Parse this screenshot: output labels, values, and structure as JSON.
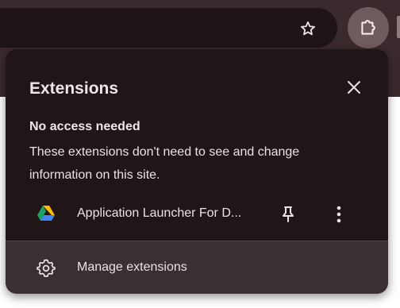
{
  "toolbar": {
    "bookmark_icon": "star-outline-icon",
    "extensions_icon": "puzzle-piece-icon"
  },
  "popup": {
    "title": "Extensions",
    "close_icon": "close-icon",
    "section": {
      "heading": "No access needed",
      "description": "These extensions don't need to see and change information on this site."
    },
    "extensions": [
      {
        "name": "Application Launcher For D...",
        "icon": "google-drive-icon",
        "pin_icon": "pin-icon",
        "more_icon": "more-vertical-icon"
      }
    ],
    "footer": {
      "label": "Manage extensions",
      "icon": "gear-icon"
    }
  },
  "colors": {
    "popup_bg": "#201618",
    "footer_bg": "#3a2f31",
    "toolbar_bg": "#3b2a2d",
    "text": "#ece2e2"
  }
}
